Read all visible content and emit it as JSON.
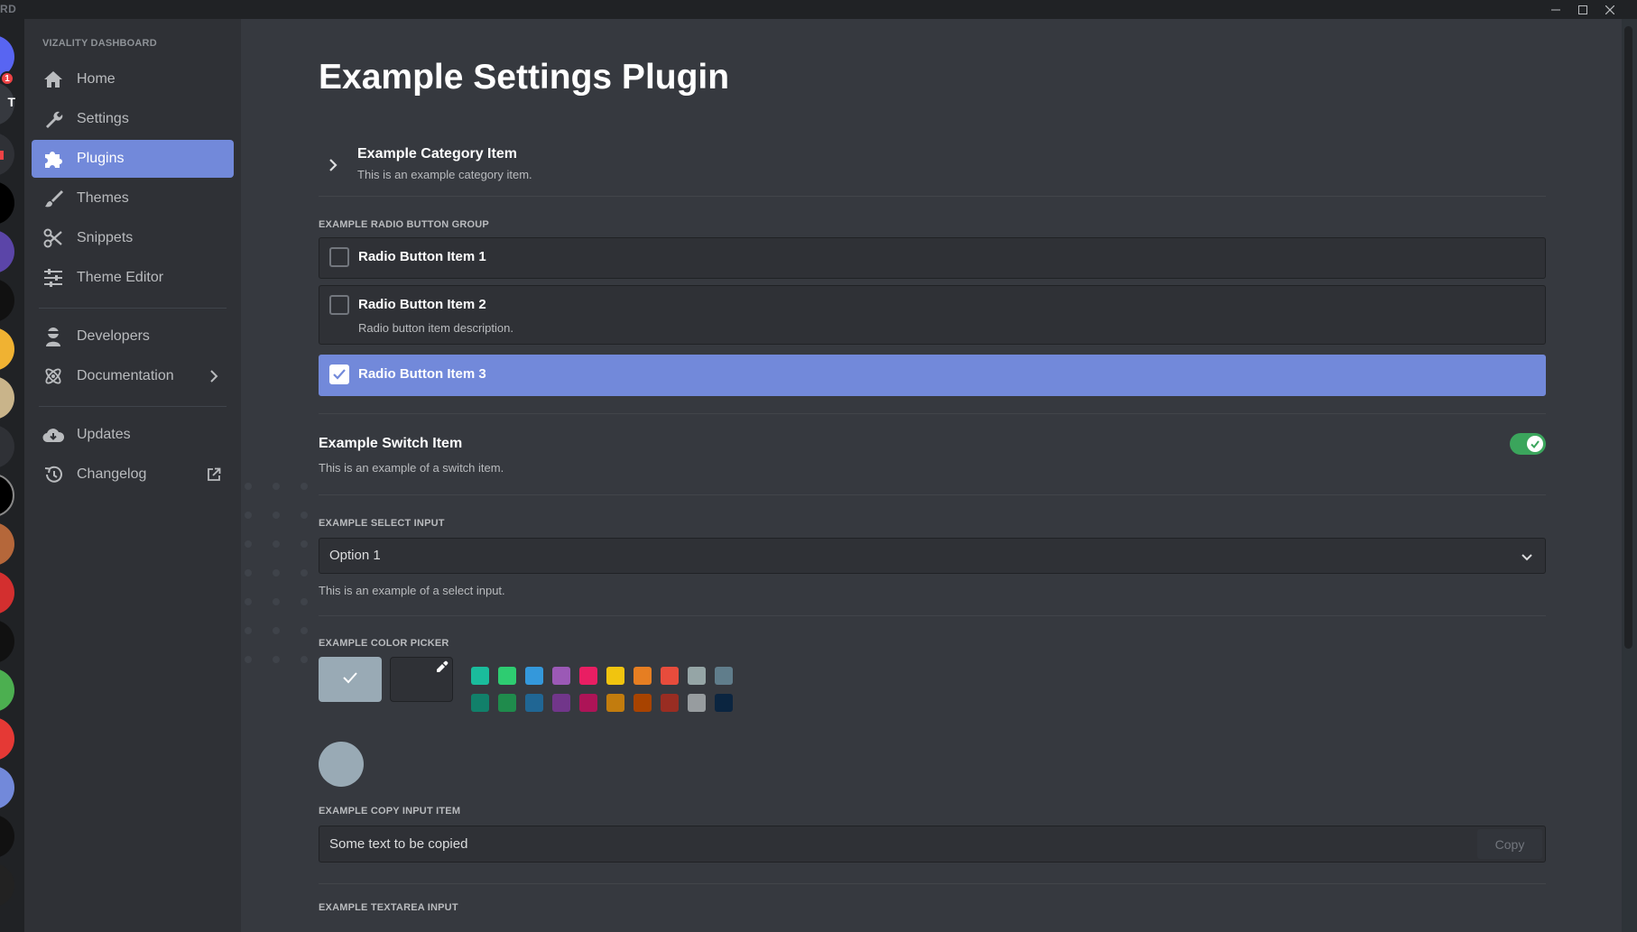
{
  "window": {
    "brand": "RD",
    "controls": [
      "minimize-icon",
      "maximize-icon",
      "close-icon"
    ]
  },
  "guilds": {
    "badge": "1",
    "letter": "T"
  },
  "sidebar": {
    "heading": "VIZALITY DASHBOARD",
    "items": [
      {
        "label": "Home",
        "icon": "home-icon"
      },
      {
        "label": "Settings",
        "icon": "wrench-icon"
      },
      {
        "label": "Plugins",
        "icon": "puzzle-icon",
        "active": true
      },
      {
        "label": "Themes",
        "icon": "brush-icon"
      },
      {
        "label": "Snippets",
        "icon": "scissors-icon"
      },
      {
        "label": "Theme Editor",
        "icon": "sliders-icon"
      },
      {
        "label": "Developers",
        "icon": "developer-icon"
      },
      {
        "label": "Documentation",
        "icon": "atom-icon",
        "trailing": "chevron-right-icon"
      },
      {
        "label": "Updates",
        "icon": "cloud-download-icon"
      },
      {
        "label": "Changelog",
        "icon": "history-icon",
        "trailing": "external-link-icon"
      }
    ]
  },
  "main": {
    "title": "Example Settings Plugin",
    "category": {
      "title": "Example Category Item",
      "description": "This is an example category item."
    },
    "radio_group": {
      "label": "EXAMPLE RADIO BUTTON GROUP",
      "items": [
        {
          "title": "Radio Button Item 1",
          "description": "",
          "selected": false
        },
        {
          "title": "Radio Button Item 2",
          "description": "Radio button item description.",
          "selected": false
        },
        {
          "title": "Radio Button Item 3",
          "description": "",
          "selected": true
        }
      ]
    },
    "switch": {
      "title": "Example Switch Item",
      "description": "This is an example of a switch item.",
      "enabled": true
    },
    "select": {
      "label": "EXAMPLE SELECT INPUT",
      "value": "Option 1",
      "hint": "This is an example of a select input."
    },
    "color_picker": {
      "label": "EXAMPLE COLOR PICKER",
      "default_color": "#99aab5",
      "row1": [
        "#1abc9c",
        "#2ecc71",
        "#3498db",
        "#9b59b6",
        "#e91e63",
        "#f1c40f",
        "#e67e22",
        "#e74c3c",
        "#95a5a6",
        "#607d8b"
      ],
      "row2": [
        "#11806a",
        "#1f8b4c",
        "#206694",
        "#71368a",
        "#ad1457",
        "#c27c0e",
        "#a84300",
        "#992d22",
        "#979c9f",
        "#0b2540"
      ],
      "preview_color": "#99aab5"
    },
    "copy_input": {
      "label": "EXAMPLE COPY INPUT ITEM",
      "value": "Some text to be copied",
      "button": "Copy"
    },
    "textarea": {
      "label": "EXAMPLE TEXTAREA INPUT"
    }
  },
  "colors": {
    "accent": "#7289da",
    "switch_on": "#3ba55c"
  }
}
